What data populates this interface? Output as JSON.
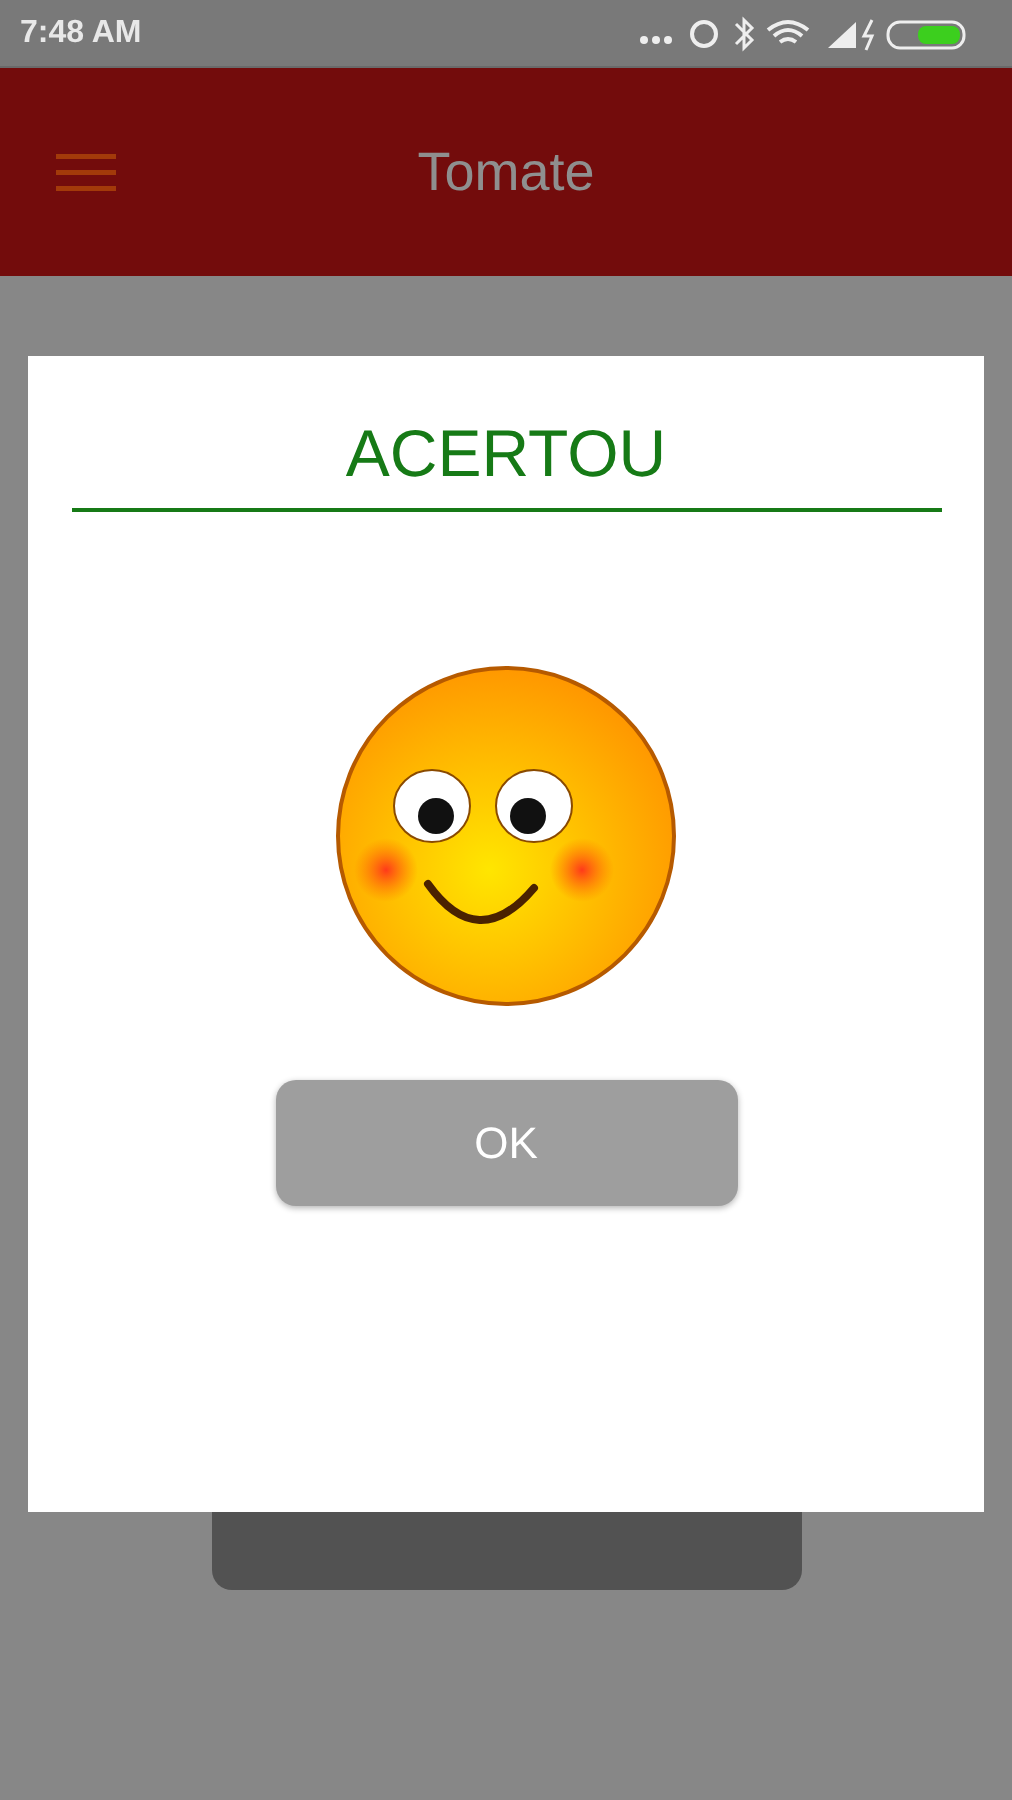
{
  "status_bar": {
    "time": "7:48 AM"
  },
  "app_bar": {
    "title": "Tomate"
  },
  "dialog": {
    "title": "ACERTOU",
    "button": {
      "label": "OK"
    }
  }
}
